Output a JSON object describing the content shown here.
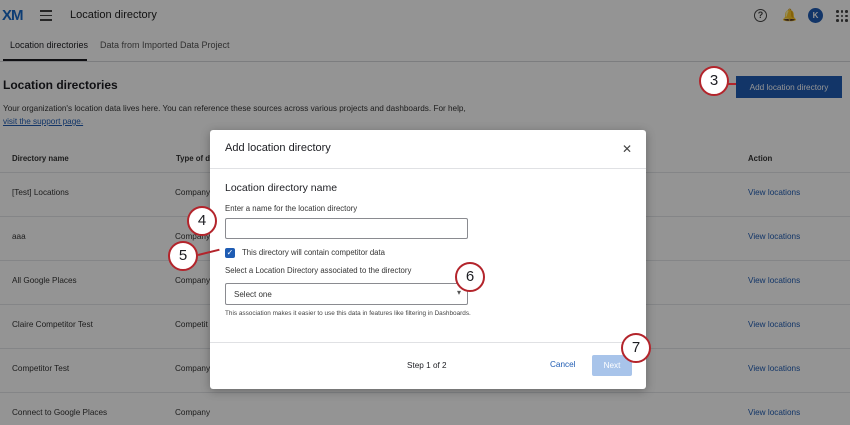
{
  "header": {
    "logo": "XM",
    "title": "Location directory",
    "help_glyph": "?",
    "bell_glyph": "🔔",
    "avatar_initial": "K"
  },
  "tabs": [
    {
      "label": "Location directories",
      "active": true
    },
    {
      "label": "Data from Imported Data Project",
      "active": false
    }
  ],
  "page": {
    "title": "Location directories",
    "description": "Your organization's location data lives here. You can reference these sources across various projects and dashboards. For help,",
    "support_link": "visit the support page.",
    "add_button": "Add location directory"
  },
  "table": {
    "headers": {
      "name": "Directory name",
      "type": "Type of di",
      "action": "Action"
    },
    "rows": [
      {
        "name": "[Test] Locations",
        "type": "Company",
        "action": "View locations"
      },
      {
        "name": "aaa",
        "type": "Company",
        "action": "View locations"
      },
      {
        "name": "All Google Places",
        "type": "Company",
        "action": "View locations"
      },
      {
        "name": "Claire Competitor Test",
        "type": "Competit",
        "action": "View locations"
      },
      {
        "name": "Competitor Test",
        "type": "Company",
        "action": "View locations"
      },
      {
        "name": "Connect to Google Places",
        "type": "Company",
        "action": "View locations"
      }
    ]
  },
  "modal": {
    "title": "Add location directory",
    "close_glyph": "✕",
    "section_title": "Location directory name",
    "name_label": "Enter a name for the location directory",
    "name_value": "",
    "checkbox_label": "This directory will contain competitor data",
    "checkbox_checked": true,
    "select_label": "Select a Location Directory associated to the directory",
    "select_value": "Select one",
    "help_text": "This association makes it easier to use this data in features like filtering in Dashboards.",
    "step": "Step 1 of 2",
    "cancel": "Cancel",
    "next": "Next"
  },
  "callouts": [
    "3",
    "4",
    "5",
    "6",
    "7"
  ],
  "colors": {
    "accent": "#1f5cb3",
    "callout": "#b3242b",
    "next_disabled": "#a8c4ea"
  }
}
